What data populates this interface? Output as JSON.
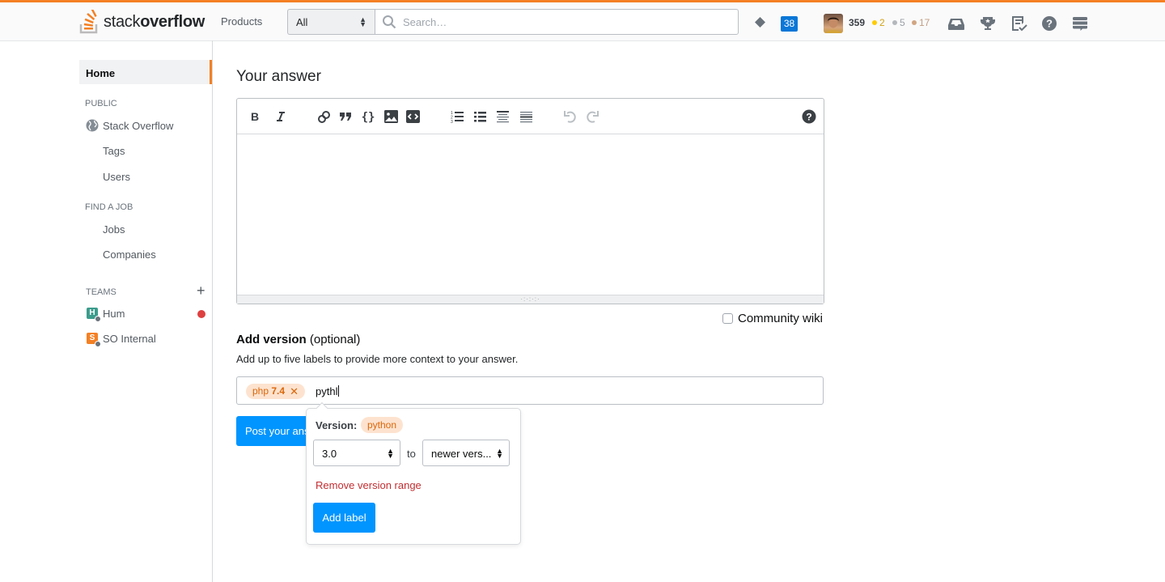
{
  "header": {
    "logo_text_light": "stack",
    "logo_text_bold": "overflow",
    "products_label": "Products",
    "search_scope": "All",
    "search_placeholder": "Search…",
    "inbox_count": "38",
    "reputation": "359",
    "badges": {
      "gold": "2",
      "silver": "5",
      "bronze": "17"
    },
    "icons": [
      "diamond-icon",
      "inbox-icon",
      "trophy-icon",
      "review-icon",
      "help-icon",
      "stackexchange-icon"
    ]
  },
  "sidebar": {
    "home": "Home",
    "public_heading": "PUBLIC",
    "stack_overflow": "Stack Overflow",
    "tags": "Tags",
    "users": "Users",
    "jobs_heading": "FIND A JOB",
    "jobs": "Jobs",
    "companies": "Companies",
    "teams_heading": "TEAMS",
    "teams": [
      {
        "initial": "H",
        "name": "Hum",
        "color": "#3c9c8c",
        "notification": true
      },
      {
        "initial": "S",
        "name": "SO Internal",
        "color": "#f48024",
        "notification": false
      }
    ]
  },
  "main": {
    "title": "Your answer",
    "toolbar": [
      "bold",
      "italic",
      "link",
      "blockquote",
      "code",
      "image",
      "snippet",
      "ordered-list",
      "unordered-list",
      "heading",
      "horizontal-rule",
      "undo",
      "redo",
      "help"
    ],
    "editor_content": "",
    "resizer_glyph": "·:·:·:·",
    "community_wiki_label": "Community wiki",
    "community_wiki_checked": false,
    "add_version_title": "Add version",
    "add_version_optional": " (optional)",
    "add_version_desc": "Add up to five labels to provide more context to your answer.",
    "labels": [
      {
        "name": "php",
        "version": "7.4"
      }
    ],
    "typed_value": "pythl",
    "post_button": "Post your answer"
  },
  "popover": {
    "label": "Version:",
    "tag": "python",
    "from_version": "3.0",
    "to_text": "to",
    "to_version": "newer vers...",
    "remove_link": "Remove version range",
    "add_button": "Add label"
  },
  "colors": {
    "brand_orange": "#f48024",
    "primary_blue": "#0095ff",
    "danger_red": "#c22e32",
    "tag_bg": "#fde3cf",
    "tag_text": "#da670b"
  }
}
